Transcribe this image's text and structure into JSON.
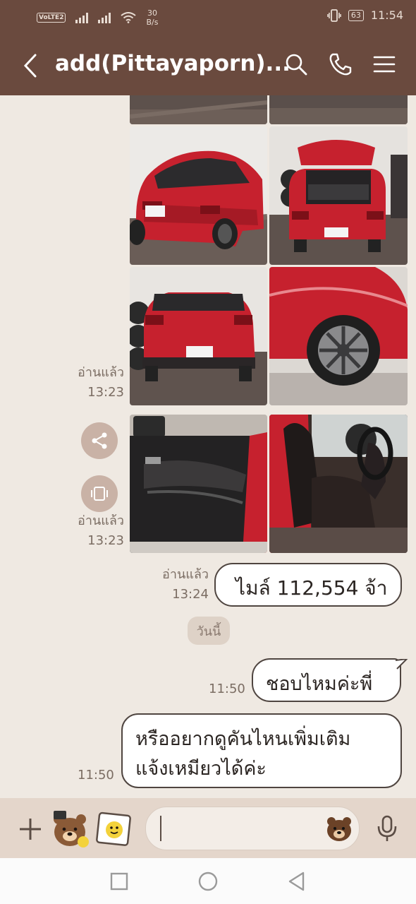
{
  "status": {
    "volte": "VoLTE",
    "volte_sub": "2",
    "speed_value": "30",
    "speed_unit": "B/s",
    "battery": "63",
    "time": "11:54"
  },
  "header": {
    "title": "add(Pittayaporn)..."
  },
  "messages": {
    "read_label": "อ่านแล้ว",
    "photos1_time": "13:23",
    "photos2_time": "13:23",
    "mileage_time": "13:24",
    "mileage_text": "ไมล์ 112,554 จ้า",
    "date_chip": "วันนี้",
    "ask_time": "11:50",
    "ask_text": "ชอบไหมค่ะพี่",
    "more_time": "11:50",
    "more_line1": "หรืออยากดูคันไหนเพิ่มเติม",
    "more_line2": "แจ้งเหมียวได้ค่ะ"
  },
  "colors": {
    "header_bg": "#6a4a3e",
    "chat_bg": "#efe9e2",
    "input_bar_bg": "#e4d6cb",
    "car_red": "#c6212e"
  },
  "icons": {
    "back": "chevron-left-icon",
    "search": "search-icon",
    "call": "phone-icon",
    "menu": "hamburger-menu-icon",
    "share": "share-icon",
    "keep": "keep-icon",
    "plus": "plus-icon",
    "sticker": "sticker-icon",
    "photo": "photo-icon",
    "emoji": "emoji-icon",
    "mic": "mic-icon"
  }
}
